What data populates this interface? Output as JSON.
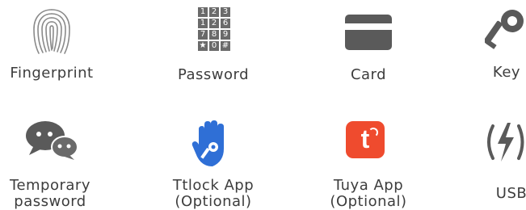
{
  "features": [
    {
      "id": "fingerprint",
      "label": [
        "Fingerprint"
      ],
      "icon": "fingerprint-icon"
    },
    {
      "id": "password",
      "label": [
        "Password"
      ],
      "icon": "keypad-icon",
      "keypad": [
        "1",
        "2",
        "3",
        "1",
        "2",
        "6",
        "7",
        "8",
        "9",
        "★",
        "0",
        "#"
      ]
    },
    {
      "id": "card",
      "label": [
        "Card"
      ],
      "icon": "card-icon"
    },
    {
      "id": "key",
      "label": [
        "Key"
      ],
      "icon": "key-icon"
    },
    {
      "id": "temporary-password",
      "label": [
        "Temporary",
        "password"
      ],
      "icon": "chat-bubbles-icon"
    },
    {
      "id": "ttlock-app",
      "label": [
        "Ttlock App",
        "(Optional)"
      ],
      "icon": "ttlock-hand-icon"
    },
    {
      "id": "tuya-app",
      "label": [
        "Tuya App",
        "(Optional)"
      ],
      "icon": "tuya-icon",
      "badge": "t"
    },
    {
      "id": "usb",
      "label": [
        "USB"
      ],
      "icon": "usb-charge-icon"
    }
  ],
  "colors": {
    "icon_gray": "#5a5a5a",
    "text": "#3d3d3d",
    "ttlock_blue": "#2f6fd6",
    "tuya_orange": "#ef4b2e"
  }
}
